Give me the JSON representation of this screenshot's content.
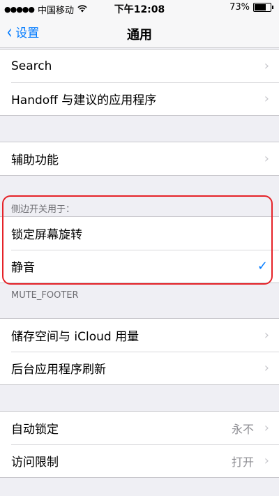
{
  "status": {
    "signal": "●●●●●",
    "carrier": "中国移动",
    "wifi_icon": "wifi-icon",
    "time": "下午12:08",
    "battery_text": "73%",
    "battery_level": 0.73
  },
  "nav": {
    "back_label": "设置",
    "title": "通用"
  },
  "groups": {
    "g1": [
      "Search",
      "Handoff 与建议的应用程序"
    ],
    "g2": [
      "辅助功能"
    ],
    "side_switch": {
      "header": "侧边开关用于：",
      "items": [
        "锁定屏幕旋转",
        "静音"
      ],
      "selected": "静音",
      "footer": "MUTE_FOOTER"
    },
    "g4": [
      "储存空间与 iCloud 用量",
      "后台应用程序刷新"
    ],
    "g5": [
      {
        "label": "自动锁定",
        "value": "永不"
      },
      {
        "label": "访问限制",
        "value": "打开"
      }
    ]
  },
  "colors": {
    "accent": "#007aff",
    "highlight": "#e52228"
  }
}
